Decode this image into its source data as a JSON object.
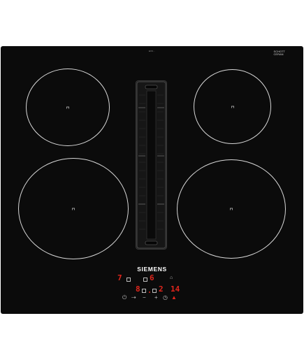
{
  "hob": {
    "brand": "SIEMENS",
    "model_code": "EV6...",
    "glass_maker": [
      "SCHOTT",
      "CERAN"
    ],
    "glass_note": "",
    "colors": {
      "panel": "#0b0b0b",
      "display_red": "#e1261c",
      "ring": "#d8d8d8",
      "brand_text": "#ffffff"
    },
    "zones": [
      "front-left",
      "rear-left",
      "rear-right",
      "front-right"
    ],
    "vent": {
      "name": "downdraft-extraction-vent"
    },
    "controls": {
      "display_left_top": "7",
      "display_right_top": "6",
      "display_left_bottom": "8",
      "display_mid_bottom": "2",
      "display_right_bottom": "14",
      "power_icon": "power-icon",
      "wipe_protect_icon": "wipe-protect-icon",
      "minus_label": "−",
      "plus_label": "+",
      "timer_icon": "timer-icon",
      "hood_icon": "extraction-icon",
      "bell_icon": "bell-icon"
    }
  }
}
